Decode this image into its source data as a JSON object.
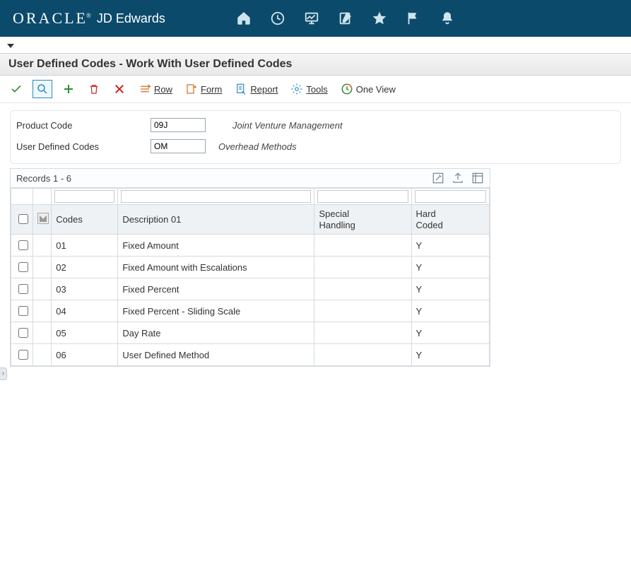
{
  "banner": {
    "brand": "ORACLE",
    "product": "JD Edwards"
  },
  "titlebar": "User Defined Codes - Work With User Defined Codes",
  "toolbar": {
    "row": "Row",
    "form": "Form",
    "report": "Report",
    "tools": "Tools",
    "oneview": "One View"
  },
  "filters": {
    "productCode": {
      "label": "Product Code",
      "value": "09J",
      "desc": "Joint Venture Management"
    },
    "userDefinedCodes": {
      "label": "User Defined Codes",
      "value": "OM",
      "desc": "Overhead Methods"
    }
  },
  "grid": {
    "records_label": "Records 1 - 6",
    "columns": {
      "codes": "Codes",
      "desc": "Description 01",
      "special_l1": "Special",
      "special_l2": "Handling",
      "hard_l1": "Hard",
      "hard_l2": "Coded"
    },
    "rows": [
      {
        "code": "01",
        "desc": "Fixed Amount",
        "special": "",
        "hard": "Y"
      },
      {
        "code": "02",
        "desc": "Fixed Amount with Escalations",
        "special": "",
        "hard": "Y"
      },
      {
        "code": "03",
        "desc": "Fixed Percent",
        "special": "",
        "hard": "Y"
      },
      {
        "code": "04",
        "desc": "Fixed Percent - Sliding Scale",
        "special": "",
        "hard": "Y"
      },
      {
        "code": "05",
        "desc": "Day Rate",
        "special": "",
        "hard": "Y"
      },
      {
        "code": "06",
        "desc": "User Defined Method",
        "special": "",
        "hard": "Y"
      }
    ]
  }
}
